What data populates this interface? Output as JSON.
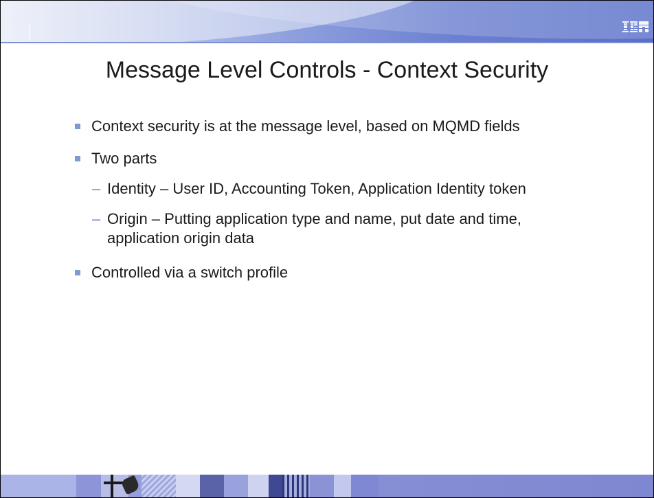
{
  "slide": {
    "title": "Message Level Controls - Context Security",
    "logo_text": "IBM"
  },
  "bullets": [
    {
      "text": "Context security is at the message level, based on MQMD fields"
    },
    {
      "text": "Two parts"
    },
    {
      "text": "Controlled via a switch profile"
    }
  ],
  "sub_bullets": [
    {
      "dash": "–",
      "text": "Identity – User ID, Accounting Token, Application Identity token"
    },
    {
      "dash": "–",
      "text": "Origin – Putting application type and name, put date and time,"
    },
    {
      "text": "application origin data"
    }
  ],
  "colors": {
    "bullet_square": "#7c9ad6",
    "dash": "#5e7fd0",
    "banner": "#6b80d0"
  }
}
